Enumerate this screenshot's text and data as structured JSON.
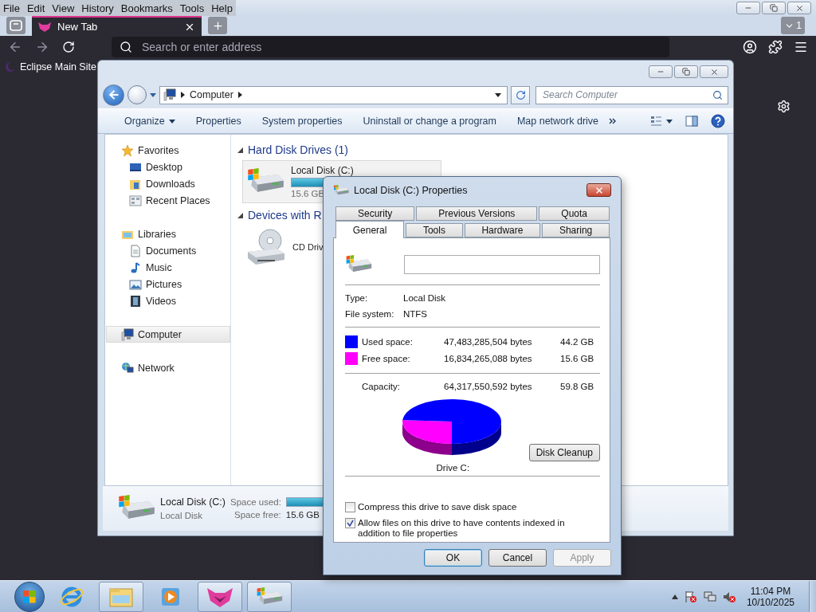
{
  "browser": {
    "menu": [
      "File",
      "Edit",
      "View",
      "History",
      "Bookmarks",
      "Tools",
      "Help"
    ],
    "tab": {
      "title": "New Tab",
      "selected": true
    },
    "tab_count": "1",
    "address_placeholder": "Search or enter address",
    "bookmarks": [
      "Eclipse Main Site"
    ]
  },
  "explorer": {
    "breadcrumb": [
      "Computer"
    ],
    "search_placeholder": "Search Computer",
    "toolbar": [
      "Organize",
      "Properties",
      "System properties",
      "Uninstall or change a program",
      "Map network drive"
    ],
    "nav": [
      {
        "label": "Favorites",
        "kind": "star",
        "selected": false,
        "children": [
          {
            "label": "Desktop",
            "kind": "desktop",
            "selected": false
          },
          {
            "label": "Downloads",
            "kind": "downloads",
            "selected": false
          },
          {
            "label": "Recent Places",
            "kind": "recent",
            "selected": false
          }
        ]
      },
      {
        "label": "Libraries",
        "kind": "libraries",
        "selected": false,
        "children": [
          {
            "label": "Documents",
            "kind": "document",
            "selected": false
          },
          {
            "label": "Music",
            "kind": "music",
            "selected": false
          },
          {
            "label": "Pictures",
            "kind": "picture",
            "selected": false
          },
          {
            "label": "Videos",
            "kind": "video",
            "selected": false
          }
        ]
      },
      {
        "label": "Computer",
        "kind": "computer",
        "selected": true
      },
      {
        "label": "Network",
        "kind": "network",
        "selected": false
      }
    ],
    "sections": [
      {
        "title": "Hard Disk Drives (1)",
        "items": [
          {
            "name": "Local Disk (C:)",
            "kind": "disk",
            "level": 0.74,
            "info": "15.6 GB"
          }
        ]
      },
      {
        "title": "Devices with R",
        "items": [
          {
            "name": "CD Driv",
            "kind": "cd"
          }
        ]
      }
    ],
    "details": {
      "name": "Local Disk (C:)",
      "type": "Local Disk",
      "used_label": "Space used:",
      "level": 0.74,
      "free_label": "Space free:",
      "free": "15.6 GB"
    }
  },
  "dialog": {
    "title": "Local Disk (C:) Properties",
    "tab_rows": [
      [
        {
          "label": "Security",
          "selected": false
        },
        {
          "label": "Previous Versions",
          "selected": false
        },
        {
          "label": "Quota",
          "selected": false
        }
      ],
      [
        {
          "label": "General",
          "selected": true
        },
        {
          "label": "Tools",
          "selected": false
        },
        {
          "label": "Hardware",
          "selected": false
        },
        {
          "label": "Sharing",
          "selected": false
        }
      ]
    ],
    "info": [
      {
        "label": "Type:",
        "value": "Local Disk"
      },
      {
        "label": "File system:",
        "value": "NTFS"
      }
    ],
    "usage": [
      {
        "label": "Used space:",
        "bytes": "47,483,285,504 bytes",
        "size": "44.2 GB",
        "color": "#0000ff"
      },
      {
        "label": "Free space:",
        "bytes": "16,834,265,088 bytes",
        "size": "15.6 GB",
        "color": "#ff00ff"
      }
    ],
    "capacity": {
      "label": "Capacity:",
      "bytes": "64,317,550,592 bytes",
      "size": "59.8 GB"
    },
    "chart_label": "Drive C:",
    "cleanup": "Disk Cleanup",
    "options": [
      {
        "label": "Compress this drive to save disk space",
        "checked": false
      },
      {
        "label": "Allow files on this drive to have contents indexed in addition to file properties",
        "checked": true
      }
    ],
    "buttons": [
      {
        "label": "OK",
        "default": true,
        "disabled": false
      },
      {
        "label": "Cancel",
        "default": false,
        "disabled": false
      },
      {
        "label": "Apply",
        "default": false,
        "disabled": true
      }
    ]
  },
  "taskbar": {
    "apps": [
      {
        "kind": "ie",
        "running": false
      },
      {
        "kind": "explorer",
        "running": true
      },
      {
        "kind": "media",
        "running": false
      },
      {
        "kind": "browser",
        "running": true
      },
      {
        "kind": "disk",
        "running": true
      }
    ],
    "time": "11:04 PM",
    "date": "10/10/2025"
  }
}
